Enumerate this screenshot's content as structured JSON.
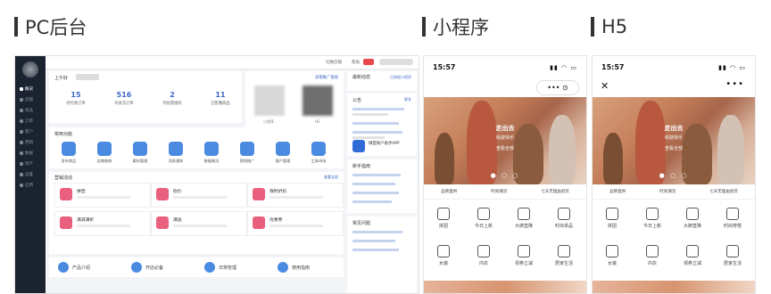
{
  "sections": {
    "pc": "PC后台",
    "mini": "小程序",
    "h5": "H5"
  },
  "pc": {
    "sidebar": [
      "概况",
      "店铺",
      "商品",
      "订单",
      "客户",
      "营销",
      "数据",
      "资产",
      "设置",
      "应用"
    ],
    "topbar": {
      "link1": "切换店铺",
      "link2": "帮助"
    },
    "greeting": "上午好",
    "stats": [
      {
        "num": "15",
        "label": "待付款订单"
      },
      {
        "num": "516",
        "label": "待发货订单"
      },
      {
        "num": "2",
        "label": "待处理维权"
      },
      {
        "num": "11",
        "label": "已售罄商品"
      }
    ],
    "qr": {
      "link": "获取推广链接",
      "cap1": "小程序",
      "cap2": "H5"
    },
    "tools_title": "常用功能",
    "tools": [
      {
        "label": "发布商品",
        "color": "#4a8ae0"
      },
      {
        "label": "店铺装修",
        "color": "#4a8ae0"
      },
      {
        "label": "素材管理",
        "color": "#4a8ae0"
      },
      {
        "label": "消息通知",
        "color": "#4a8ae0"
      },
      {
        "label": "数据概况",
        "color": "#4a8ae0"
      },
      {
        "label": "营销推广",
        "color": "#4a8ae0"
      },
      {
        "label": "客户管理",
        "color": "#4a8ae0"
      },
      {
        "label": "工具市场",
        "color": "#4a8ae0"
      }
    ],
    "market_title": "营销活动",
    "market_more": "查看全部",
    "market": [
      {
        "label": "拼团",
        "color": "#e95f7e"
      },
      {
        "label": "砍价",
        "color": "#e95f7e"
      },
      {
        "label": "限时折扣",
        "color": "#e95f7e"
      },
      {
        "label": "满减满折",
        "color": "#e95f7e"
      },
      {
        "label": "满送",
        "color": "#e95f7e"
      },
      {
        "label": "优惠券",
        "color": "#e95f7e"
      }
    ],
    "bottom": [
      "产品介绍",
      "开店必备",
      "日常管理",
      "使用指南"
    ],
    "right": {
      "h1": "最新动态",
      "h1more": "已授权小程序",
      "h2": "公告",
      "h2more": "更多",
      "app": "微盟商户助手APP",
      "h3": "新手指南",
      "h4": "常见问题"
    }
  },
  "mini": {
    "time": "15:57",
    "capsule": "•••  ⊙"
  },
  "h5": {
    "time": "15:57",
    "close": "✕",
    "more": "•••"
  },
  "phone": {
    "banner_t1": "走出去",
    "banner_t2": "收获快乐",
    "banner_t3": "查看全部",
    "features": [
      "品牌直供",
      "时尚潮流",
      "七天无理由退货"
    ],
    "cats_row1": [
      "拼团",
      "今日上新",
      "大牌直降",
      "时尚单品"
    ],
    "cats_row2": [
      "女装",
      "内衣",
      "领券立减",
      "居家生活"
    ],
    "h5_cats_row1": [
      "拼团",
      "今日上新",
      "大牌直降",
      "时尚穿搭"
    ],
    "h5_cats_row2": [
      "女装",
      "内衣",
      "领券立减",
      "居家生活"
    ]
  }
}
